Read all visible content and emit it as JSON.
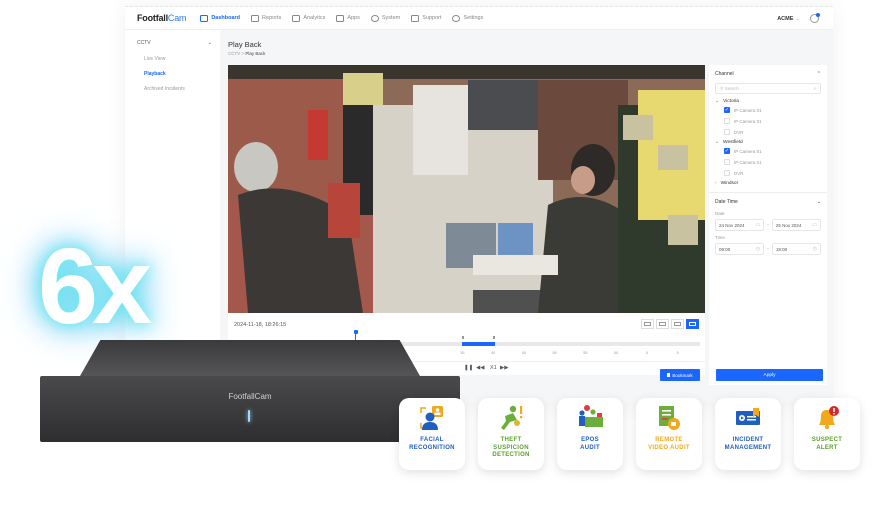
{
  "app": {
    "logo": {
      "part1": "Footfall",
      "part2": "Cam"
    },
    "nav": [
      {
        "label": "Dashboard",
        "icon": "dashboard-icon",
        "active": true
      },
      {
        "label": "Reports",
        "icon": "reports-icon",
        "active": false
      },
      {
        "label": "Analytics",
        "icon": "analytics-icon",
        "active": false
      },
      {
        "label": "Apps",
        "icon": "apps-icon",
        "active": false
      },
      {
        "label": "System",
        "icon": "system-icon",
        "active": false
      },
      {
        "label": "Support",
        "icon": "support-icon",
        "active": false
      },
      {
        "label": "Settings",
        "icon": "settings-icon",
        "active": false
      }
    ],
    "account": "ACME",
    "sidebar": {
      "group": "CCTV",
      "items": [
        {
          "label": "Live View",
          "active": false
        },
        {
          "label": "Playback",
          "active": true
        },
        {
          "label": "Archived Incidents",
          "active": false
        }
      ]
    },
    "page_title": "Play Back",
    "breadcrumb": {
      "root": "CCTV",
      "sep": ">",
      "current": "Play Back"
    },
    "player": {
      "timestamp": "2024-11-18, 18:26:15",
      "playhead_fraction": 0.26,
      "selection_fraction": [
        0.49,
        0.56
      ],
      "tick_labels": [
        "35",
        "40",
        "45",
        "50",
        "55",
        "00",
        "0",
        "5"
      ],
      "speed": "X1",
      "bookmark_label": "Bookmark"
    },
    "filters": {
      "channel_title": "Channel",
      "search_placeholder": "Search",
      "groups": [
        {
          "name": "Victoria",
          "expanded": true,
          "items": [
            {
              "label": "IP Camera 01",
              "checked": true
            },
            {
              "label": "IP Camera 01",
              "checked": false
            },
            {
              "label": "DVR",
              "checked": false
            }
          ]
        },
        {
          "name": "Westfield",
          "expanded": true,
          "items": [
            {
              "label": "IP Camera 01",
              "checked": true
            },
            {
              "label": "IP Camera 01",
              "checked": false
            },
            {
              "label": "DVR",
              "checked": false
            }
          ]
        },
        {
          "name": "Windsor",
          "expanded": false,
          "items": []
        }
      ],
      "datetime_title": "Date Time",
      "date_label": "Date",
      "date_from": "24 Nov 2024",
      "date_to": "25 Nov 2024",
      "time_label": "Time",
      "time_from": "09:00",
      "time_to": "18:00",
      "apply_label": "Apply"
    }
  },
  "hero": {
    "multiplier": "6x",
    "device_brand": "FootfallCam"
  },
  "features": [
    {
      "line1": "FACIAL",
      "line2": "RECOGNITION",
      "line3": "",
      "color": "#1f5fbf",
      "icon": "facial-recognition-icon"
    },
    {
      "line1": "THEFT",
      "line2": "SUSPICION",
      "line3": "DETECTION",
      "color": "#5aa02c",
      "icon": "theft-suspicion-icon"
    },
    {
      "line1": "EPOS",
      "line2": "AUDIT",
      "line3": "",
      "color": "#1f5fbf",
      "icon": "epos-audit-icon"
    },
    {
      "line1": "REMOTE",
      "line2": "VIDEO AUDIT",
      "line3": "",
      "color": "#f2a81d",
      "icon": "remote-video-audit-icon"
    },
    {
      "line1": "INCIDENT",
      "line2": "MANAGEMENT",
      "line3": "",
      "color": "#1f5fbf",
      "icon": "incident-management-icon"
    },
    {
      "line1": "SUSPECT",
      "line2": "ALERT",
      "line3": "",
      "color": "#5aa02c",
      "icon": "suspect-alert-icon"
    }
  ],
  "colors": {
    "accent": "#1a66ff",
    "glow": "#6ee9f0"
  }
}
